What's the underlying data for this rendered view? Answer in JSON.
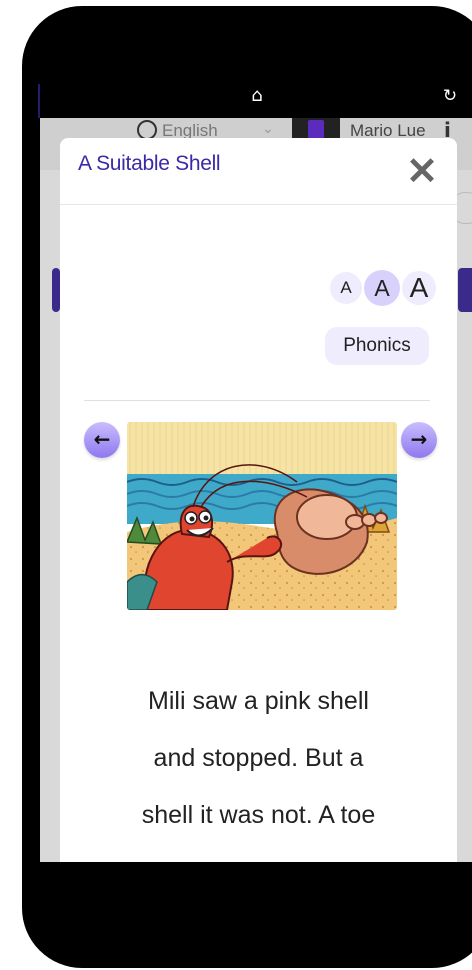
{
  "header": {
    "language": "English",
    "user_name": "Mario Lue"
  },
  "modal": {
    "title": "A Suitable Shell",
    "close_label": "✕",
    "font_sizes": [
      "A",
      "A",
      "A"
    ],
    "phonics_label": "Phonics",
    "prev_label": "←",
    "next_label": "→",
    "story_lines": [
      "Mili saw a pink shell",
      "and stopped. But a",
      "shell it was not. A toe"
    ]
  },
  "icons": {
    "home": "home-icon",
    "refresh": "refresh-icon",
    "globe": "globe-icon",
    "info": "info-icon"
  },
  "colors": {
    "accent": "#3a2aa8",
    "button_bg": "#efecfd",
    "arrow_bg": "#8f78ef"
  }
}
